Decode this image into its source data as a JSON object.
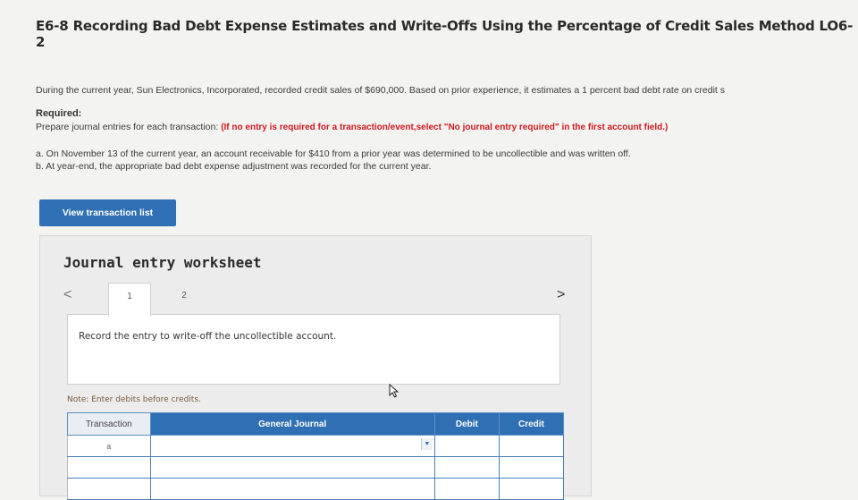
{
  "problem": {
    "title": "E6-8 Recording Bad Debt Expense Estimates and Write-Offs Using the Percentage of Credit Sales Method LO6-2",
    "intro": "During the current year, Sun Electronics, Incorporated, recorded credit sales of $690,000. Based on prior experience, it estimates a 1 percent bad debt rate on credit s",
    "required_label": "Required:",
    "required_text": "Prepare journal entries for each transaction:",
    "required_note": "(If no entry is required for a transaction/event,select \"No journal entry required\" in the first account field.)",
    "items": [
      "a. On November 13 of the current year, an account receivable for $410 from a prior year was determined to be uncollectible and was written off.",
      "b. At year-end, the appropriate bad debt expense adjustment was recorded for the current year."
    ]
  },
  "buttons": {
    "view_transactions": "View transaction list"
  },
  "worksheet": {
    "title": "Journal entry worksheet",
    "prev_glyph": "<",
    "next_glyph": ">",
    "tabs": [
      "1",
      "2"
    ],
    "active_tab": 0,
    "instruction": "Record the entry to write-off the uncollectible account.",
    "note": "Note: Enter debits before credits.",
    "table": {
      "headers": [
        "Transaction",
        "General Journal",
        "Debit",
        "Credit"
      ],
      "rows": [
        {
          "transaction": "a",
          "account": "",
          "debit": "",
          "credit": ""
        },
        {
          "transaction": "",
          "account": "",
          "debit": "",
          "credit": ""
        },
        {
          "transaction": "",
          "account": "",
          "debit": "",
          "credit": ""
        }
      ]
    }
  },
  "colors": {
    "accent": "#2f6fb3",
    "required_note": "#d0181f"
  },
  "icons": [
    "chevron-left-icon",
    "chevron-right-icon",
    "dropdown-arrow-icon",
    "mouse-pointer-icon"
  ]
}
